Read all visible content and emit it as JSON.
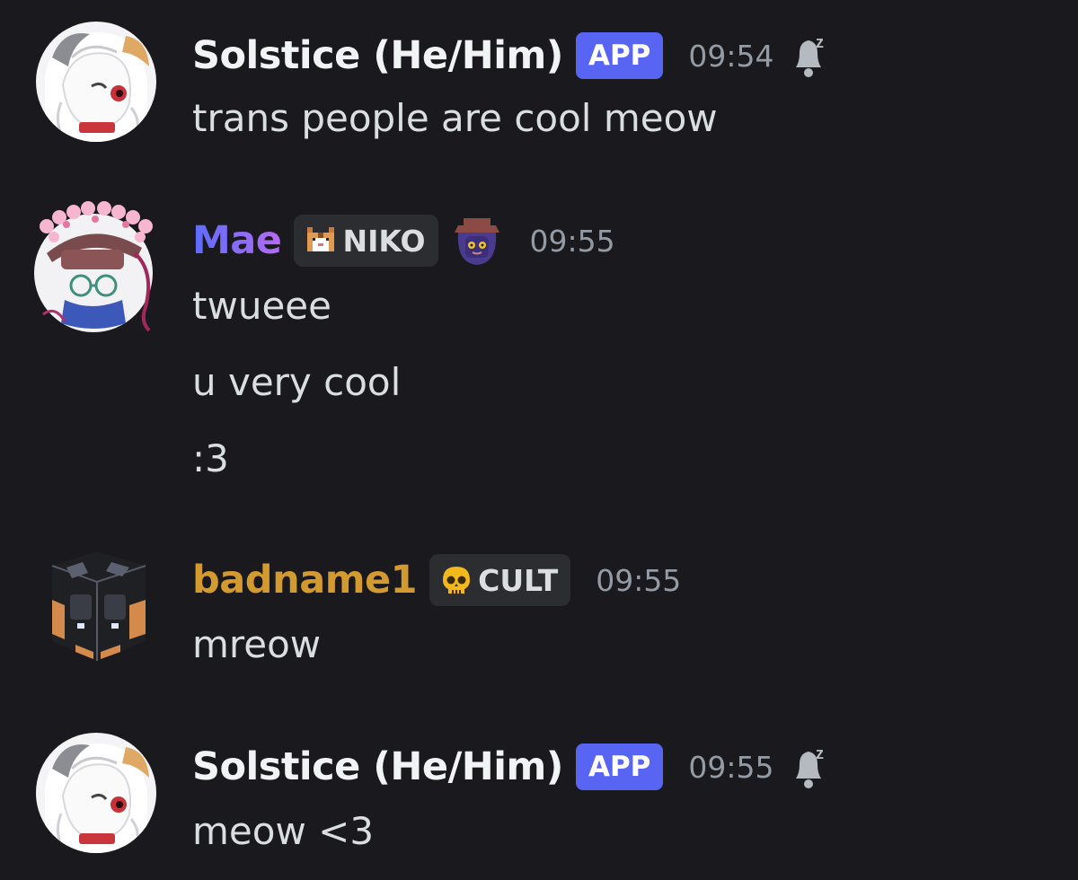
{
  "colors": {
    "background": "#1a1a1e",
    "text": "#dbdee1",
    "timestamp": "#949ba4",
    "app_badge": "#5865f2",
    "role_tag_bg": "#2b2d31",
    "name_solstice": "#f2f3f5",
    "name_mae_start": "#5b6cff",
    "name_mae_end": "#b46bf0",
    "name_badname": "#d39a2f"
  },
  "messages": [
    {
      "author": "Solstice (He/Him)",
      "badge": "APP",
      "time": "09:54",
      "status_icon": "bell-snooze-icon",
      "avatar_icon": "white-cat-girl-avatar",
      "lines": [
        "trans people are cool meow"
      ]
    },
    {
      "author": "Mae",
      "role_tag": "NIKO",
      "role_icon": "pixel-cat-icon",
      "deco_icon": "niko-character-icon",
      "time": "09:55",
      "avatar_icon": "flower-crown-ghost-avatar",
      "lines": [
        "twueee",
        "u very cool",
        ":3"
      ]
    },
    {
      "author": "badname1",
      "role_tag": "CULT",
      "role_icon": "skull-icon",
      "time": "09:55",
      "avatar_icon": "companion-cube-avatar",
      "lines": [
        "mreow"
      ]
    },
    {
      "author": "Solstice (He/Him)",
      "badge": "APP",
      "time": "09:55",
      "status_icon": "bell-snooze-icon",
      "avatar_icon": "white-cat-girl-avatar",
      "lines": [
        "meow <3"
      ]
    }
  ]
}
